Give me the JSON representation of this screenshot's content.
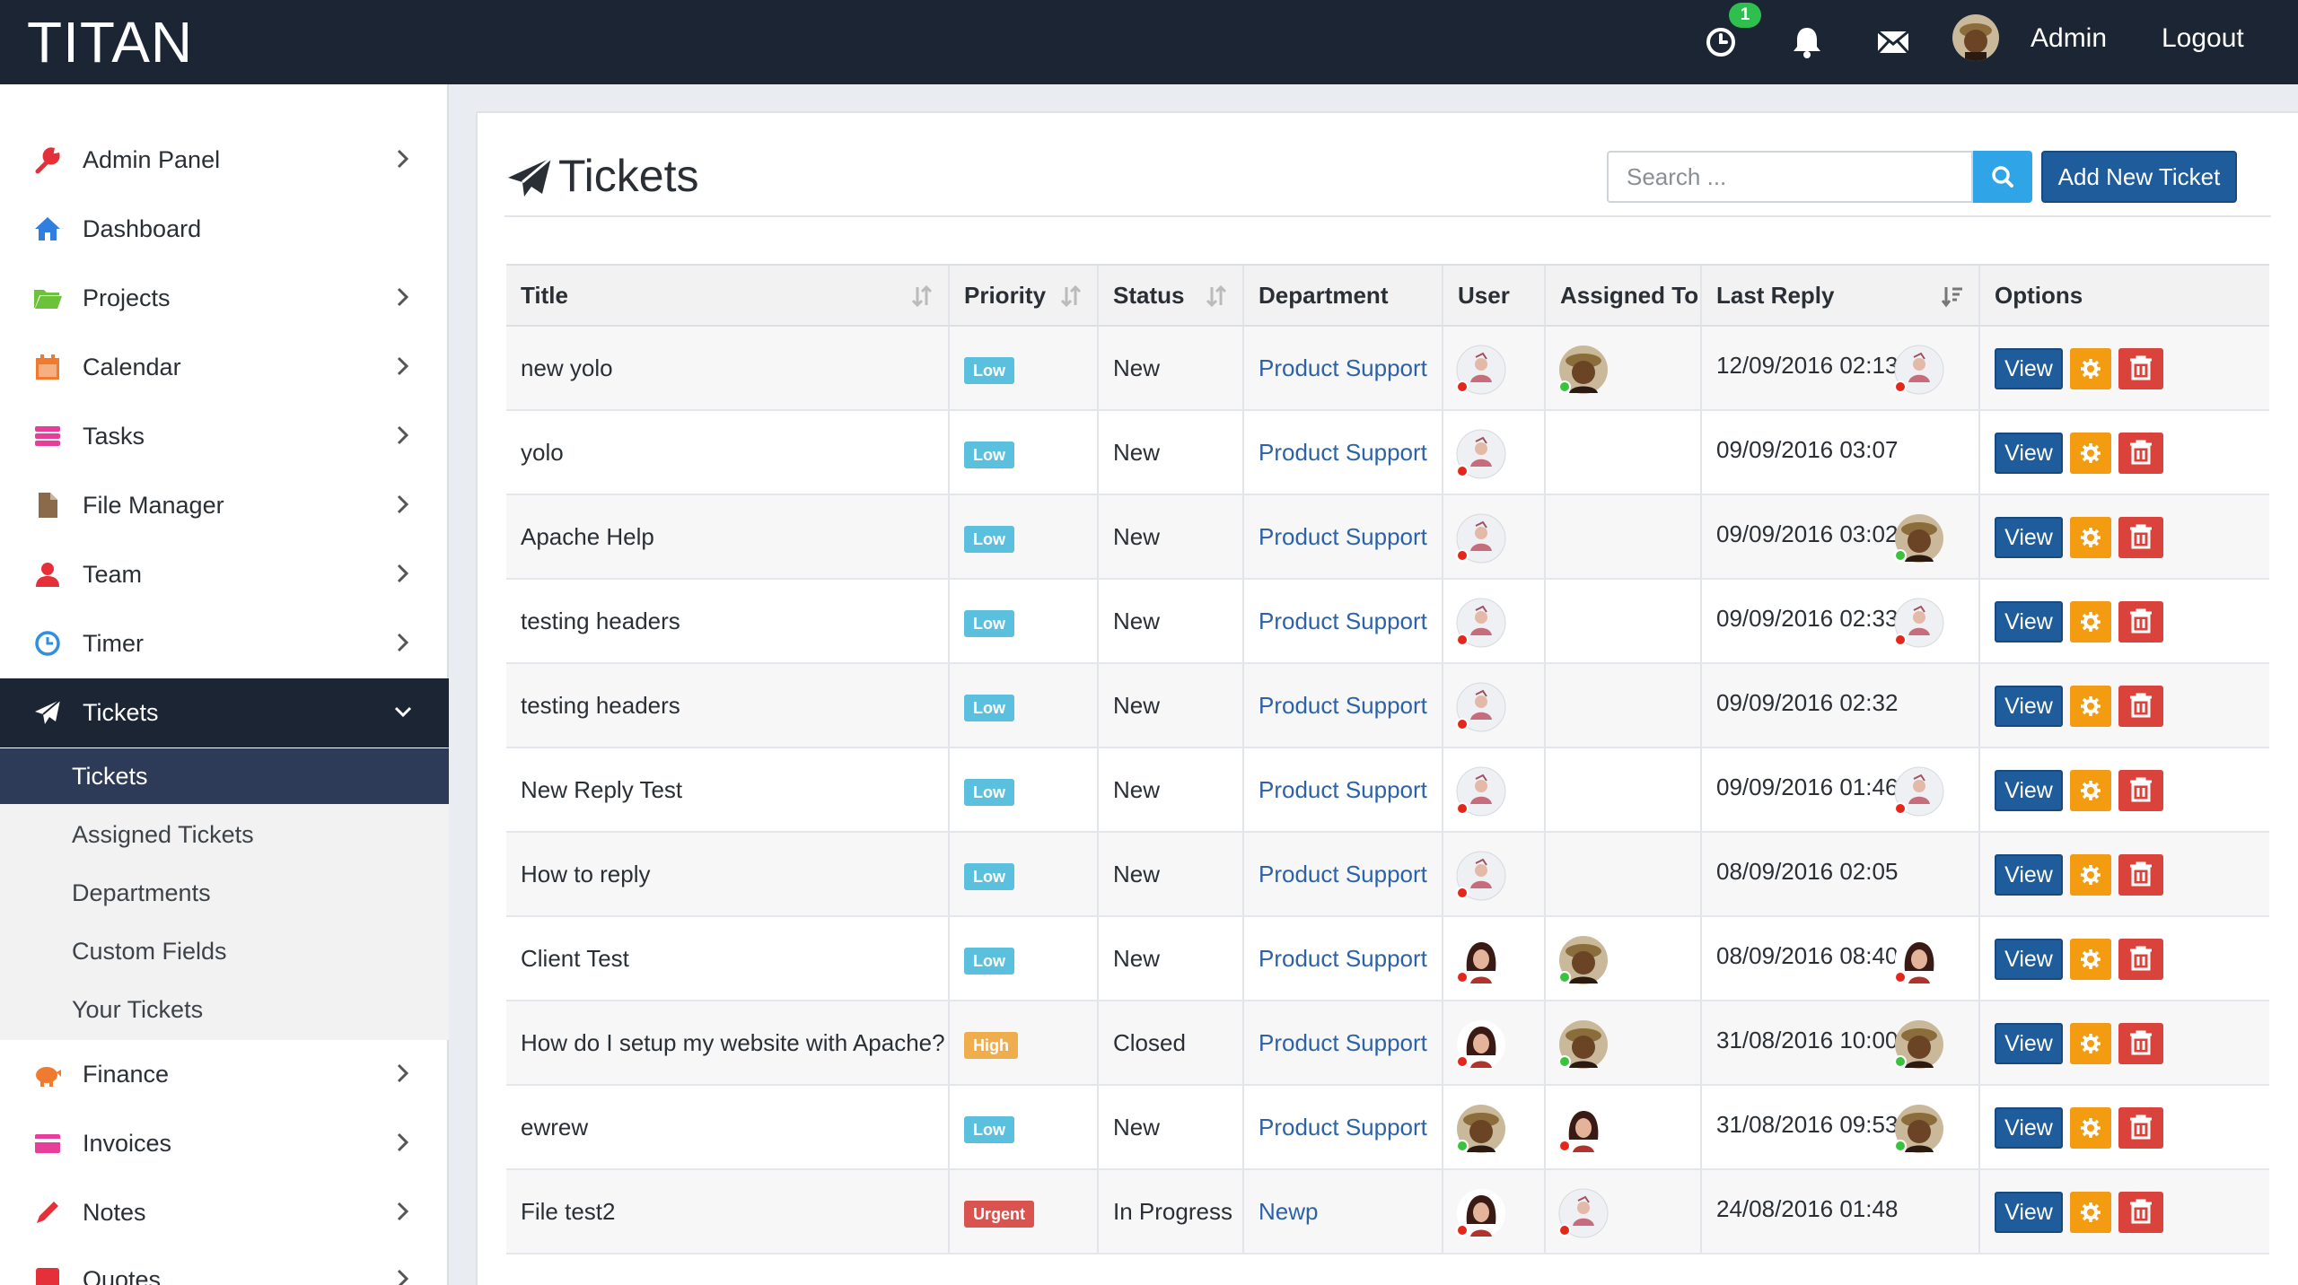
{
  "topbar": {
    "brand": "TITAN",
    "timer_badge": "1",
    "user_name": "Admin",
    "logout_label": "Logout"
  },
  "sidebar": {
    "items": [
      {
        "label": "Admin Panel",
        "icon": "wrench-icon",
        "color": "#e5303a",
        "chevron": true
      },
      {
        "label": "Dashboard",
        "icon": "home-icon",
        "color": "#2f7ee0",
        "chevron": false
      },
      {
        "label": "Projects",
        "icon": "folder-icon",
        "color": "#6cc23a",
        "chevron": true
      },
      {
        "label": "Calendar",
        "icon": "calendar-icon",
        "color": "#f07a2e",
        "chevron": true
      },
      {
        "label": "Tasks",
        "icon": "tasks-icon",
        "color": "#e83e9b",
        "chevron": true
      },
      {
        "label": "File Manager",
        "icon": "file-icon",
        "color": "#8a6a4a",
        "chevron": true
      },
      {
        "label": "Team",
        "icon": "user-icon",
        "color": "#e5303a",
        "chevron": true
      },
      {
        "label": "Timer",
        "icon": "clock-icon",
        "color": "#2f8fe0",
        "chevron": true
      },
      {
        "label": "Tickets",
        "icon": "paper-plane-icon",
        "color": "#ffffff",
        "chevron": true,
        "active": true
      },
      {
        "label": "Finance",
        "icon": "piggy-bank-icon",
        "color": "#f07a2e",
        "chevron": true
      },
      {
        "label": "Invoices",
        "icon": "credit-card-icon",
        "color": "#e83e9b",
        "chevron": true
      },
      {
        "label": "Notes",
        "icon": "pencil-icon",
        "color": "#e5303a",
        "chevron": true
      },
      {
        "label": "Quotes",
        "icon": "quote-icon",
        "color": "#e5303a",
        "chevron": true
      }
    ],
    "submenu": [
      {
        "label": "Tickets",
        "active": true
      },
      {
        "label": "Assigned Tickets"
      },
      {
        "label": "Departments"
      },
      {
        "label": "Custom Fields"
      },
      {
        "label": "Your Tickets"
      }
    ]
  },
  "main": {
    "title": "Tickets",
    "search_placeholder": "Search ...",
    "add_button": "Add New Ticket",
    "columns": [
      "Title",
      "Priority",
      "Status",
      "Department",
      "User",
      "Assigned To",
      "Last Reply",
      "Options"
    ],
    "view_label": "View",
    "rows": [
      {
        "title": "new yolo",
        "priority": "Low",
        "status": "New",
        "department": "Product Support",
        "user": "woman-bird",
        "assigned": "man-hat",
        "last_reply": "12/09/2016 02:13",
        "reply_by": "woman-bird"
      },
      {
        "title": "yolo",
        "priority": "Low",
        "status": "New",
        "department": "Product Support",
        "user": "woman-bird",
        "assigned": "",
        "last_reply": "09/09/2016 03:07",
        "reply_by": ""
      },
      {
        "title": "Apache Help",
        "priority": "Low",
        "status": "New",
        "department": "Product Support",
        "user": "woman-bird",
        "assigned": "",
        "last_reply": "09/09/2016 03:02",
        "reply_by": "man-hat"
      },
      {
        "title": "testing headers",
        "priority": "Low",
        "status": "New",
        "department": "Product Support",
        "user": "woman-bird",
        "assigned": "",
        "last_reply": "09/09/2016 02:33",
        "reply_by": "woman-bird"
      },
      {
        "title": "testing headers",
        "priority": "Low",
        "status": "New",
        "department": "Product Support",
        "user": "woman-bird",
        "assigned": "",
        "last_reply": "09/09/2016 02:32",
        "reply_by": ""
      },
      {
        "title": "New Reply Test",
        "priority": "Low",
        "status": "New",
        "department": "Product Support",
        "user": "woman-bird",
        "assigned": "",
        "last_reply": "09/09/2016 01:46",
        "reply_by": "woman-bird"
      },
      {
        "title": "How to reply",
        "priority": "Low",
        "status": "New",
        "department": "Product Support",
        "user": "woman-bird",
        "assigned": "",
        "last_reply": "08/09/2016 02:05",
        "reply_by": ""
      },
      {
        "title": "Client Test",
        "priority": "Low",
        "status": "New",
        "department": "Product Support",
        "user": "woman-dark",
        "assigned": "man-hat",
        "last_reply": "08/09/2016 08:40",
        "reply_by": "woman-dark"
      },
      {
        "title": "How do I setup my website with Apache?",
        "priority": "High",
        "status": "Closed",
        "department": "Product Support",
        "user": "woman-dark",
        "assigned": "man-hat",
        "last_reply": "31/08/2016 10:00",
        "reply_by": "man-hat"
      },
      {
        "title": "ewrew",
        "priority": "Low",
        "status": "New",
        "department": "Product Support",
        "user": "man-hat",
        "assigned": "woman-dark",
        "last_reply": "31/08/2016 09:53",
        "reply_by": "man-hat"
      },
      {
        "title": "File test2",
        "priority": "Urgent",
        "status": "In Progress",
        "department": "Newp",
        "user": "woman-dark",
        "assigned": "woman-bird",
        "last_reply": "24/08/2016 01:48",
        "reply_by": ""
      }
    ]
  }
}
